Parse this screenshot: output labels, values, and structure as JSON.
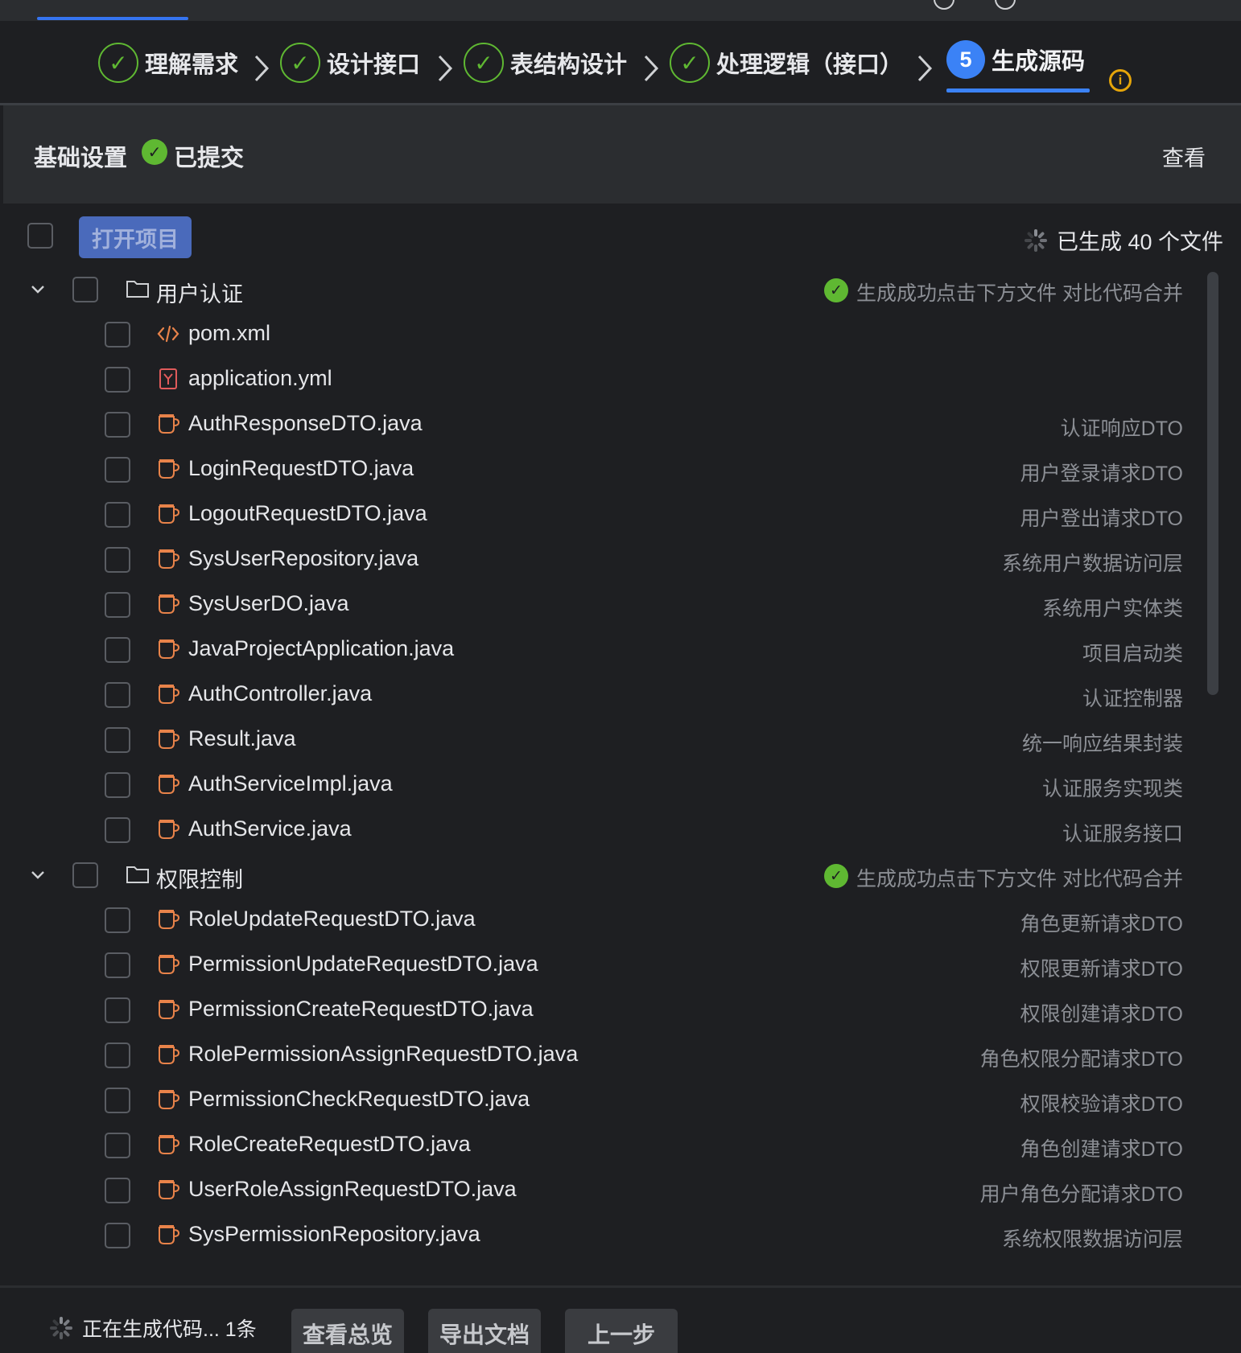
{
  "steps": [
    {
      "label": "理解需求",
      "state": "done"
    },
    {
      "label": "设计接口",
      "state": "done"
    },
    {
      "label": "表结构设计",
      "state": "done"
    },
    {
      "label": "处理逻辑（接口）",
      "state": "done"
    },
    {
      "label": "生成源码",
      "state": "current",
      "number": "5"
    }
  ],
  "basic": {
    "title": "基础设置",
    "status": "已提交",
    "view_link": "查看"
  },
  "toolbar": {
    "open_project": "打开项目",
    "generated_count": "已生成 40 个文件"
  },
  "groups": [
    {
      "name": "用户认证",
      "status": "生成成功",
      "hint": "点击下方文件 对比代码合并",
      "files": [
        {
          "name": "pom.xml",
          "desc": "",
          "icon": "xml-icon"
        },
        {
          "name": "application.yml",
          "desc": "",
          "icon": "yaml-icon"
        },
        {
          "name": "AuthResponseDTO.java",
          "desc": "认证响应DTO",
          "icon": "java-icon"
        },
        {
          "name": "LoginRequestDTO.java",
          "desc": "用户登录请求DTO",
          "icon": "java-icon"
        },
        {
          "name": "LogoutRequestDTO.java",
          "desc": "用户登出请求DTO",
          "icon": "java-icon"
        },
        {
          "name": "SysUserRepository.java",
          "desc": "系统用户数据访问层",
          "icon": "java-icon"
        },
        {
          "name": "SysUserDO.java",
          "desc": "系统用户实体类",
          "icon": "java-icon"
        },
        {
          "name": "JavaProjectApplication.java",
          "desc": "项目启动类",
          "icon": "java-icon"
        },
        {
          "name": "AuthController.java",
          "desc": "认证控制器",
          "icon": "java-icon"
        },
        {
          "name": "Result.java",
          "desc": "统一响应结果封装",
          "icon": "java-icon"
        },
        {
          "name": "AuthServiceImpl.java",
          "desc": "认证服务实现类",
          "icon": "java-icon"
        },
        {
          "name": "AuthService.java",
          "desc": "认证服务接口",
          "icon": "java-icon"
        }
      ]
    },
    {
      "name": "权限控制",
      "status": "生成成功",
      "hint": "点击下方文件 对比代码合并",
      "files": [
        {
          "name": "RoleUpdateRequestDTO.java",
          "desc": "角色更新请求DTO",
          "icon": "java-icon"
        },
        {
          "name": "PermissionUpdateRequestDTO.java",
          "desc": "权限更新请求DTO",
          "icon": "java-icon"
        },
        {
          "name": "PermissionCreateRequestDTO.java",
          "desc": "权限创建请求DTO",
          "icon": "java-icon"
        },
        {
          "name": "RolePermissionAssignRequestDTO.java",
          "desc": "角色权限分配请求DTO",
          "icon": "java-icon"
        },
        {
          "name": "PermissionCheckRequestDTO.java",
          "desc": "权限校验请求DTO",
          "icon": "java-icon"
        },
        {
          "name": "RoleCreateRequestDTO.java",
          "desc": "角色创建请求DTO",
          "icon": "java-icon"
        },
        {
          "name": "UserRoleAssignRequestDTO.java",
          "desc": "用户角色分配请求DTO",
          "icon": "java-icon"
        },
        {
          "name": "SysPermissionRepository.java",
          "desc": "系统权限数据访问层",
          "icon": "java-icon"
        }
      ]
    }
  ],
  "bottom": {
    "generating": "正在生成代码... 1条",
    "overview": "查看总览",
    "export_doc": "导出文档",
    "prev_step": "上一步"
  },
  "colors": {
    "background": "#1e1f22",
    "panel": "#2b2d30",
    "accent": "#3b82f6",
    "success": "#5fb832",
    "warning": "#e5a50a",
    "java_icon": "#e8834a",
    "yaml_icon": "#e05b5b"
  }
}
